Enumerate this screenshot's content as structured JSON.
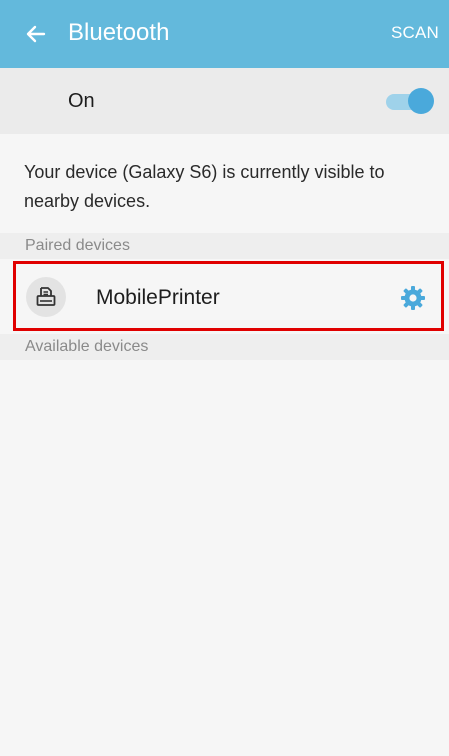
{
  "appbar": {
    "title": "Bluetooth",
    "scan_label": "SCAN",
    "back_icon": "arrow-left-icon"
  },
  "toggle_row": {
    "label": "On",
    "state": "on"
  },
  "info_text": "Your device (Galaxy S6) is currently visible to nearby devices.",
  "sections": {
    "paired_label": "Paired devices",
    "available_label": "Available devices"
  },
  "paired_devices": [
    {
      "name": "MobilePrinter",
      "icon": "printer-icon",
      "settings_icon": "gear-icon"
    }
  ],
  "colors": {
    "appbar": "#63b9dc",
    "toggle_thumb": "#4aa9db",
    "gear": "#4aa9db",
    "highlight": "#e00000"
  }
}
